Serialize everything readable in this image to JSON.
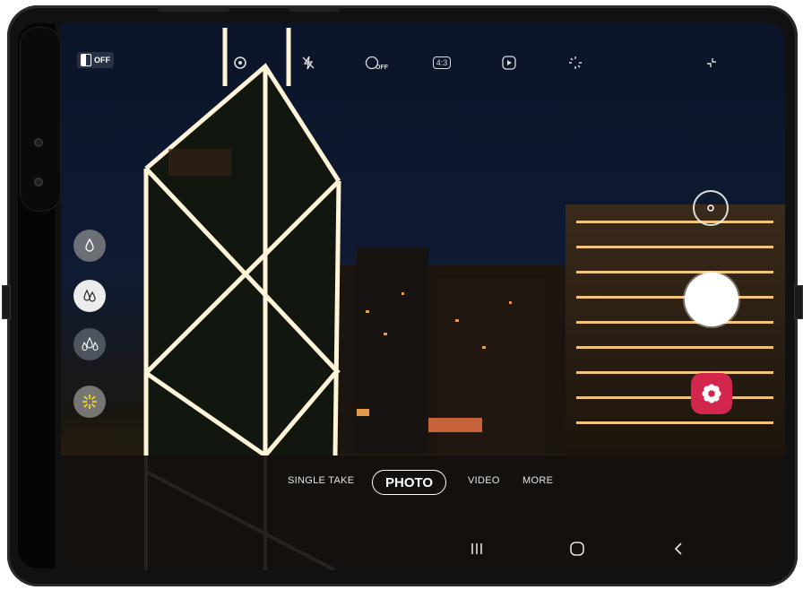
{
  "camera": {
    "top_toolbar": {
      "off_badge_label": "OFF",
      "icons": [
        "settings-icon",
        "flash-off-icon",
        "timer-off-icon",
        "aspect-ratio-icon",
        "motion-photo-icon",
        "filter-effects-icon",
        "collapse-icon"
      ],
      "timer_label": "OFF",
      "aspect_label": "4:3"
    },
    "left_filters": [
      "filter-drop-icon",
      "filter-double-drop-icon",
      "filter-triple-drop-icon",
      "beauty-sparkle-icon"
    ],
    "modes": {
      "items": [
        "SINGLE TAKE",
        "PHOTO",
        "VIDEO",
        "MORE"
      ],
      "active": "PHOTO"
    },
    "nav_bar": [
      "recent-apps-icon",
      "home-icon",
      "back-icon"
    ],
    "accent_colors": {
      "gallery": "#d2264d",
      "shutter": "#ffffff"
    }
  }
}
